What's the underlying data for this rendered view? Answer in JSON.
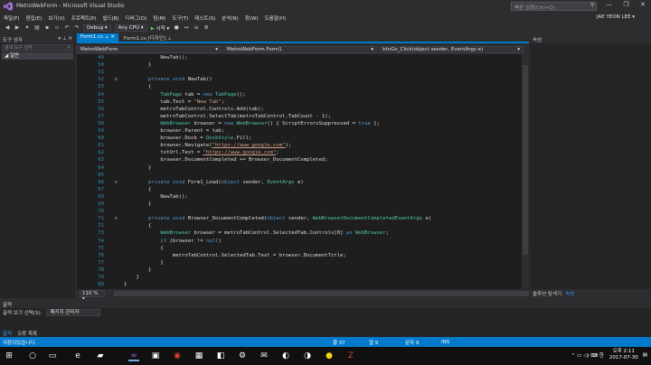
{
  "window": {
    "title": "MetroWebForm - Microsoft Visual Studio",
    "quick_launch_placeholder": "빠른 실행(Ctrl+Q)",
    "user": "JAE YEON LEE ▾"
  },
  "menu": [
    "파일(F)",
    "편집(E)",
    "보기(V)",
    "프로젝트(P)",
    "빌드(B)",
    "디버그(D)",
    "팀(M)",
    "도구(T)",
    "테스트(S)",
    "분석(N)",
    "창(W)",
    "도움말(H)"
  ],
  "toolbar": {
    "config": "Debug",
    "platform": "Any CPU",
    "start_label": "시작"
  },
  "toolbox": {
    "title": "도구 상자",
    "search_placeholder": "검색 도구 상자",
    "group": "일반"
  },
  "tabs": [
    {
      "label": "Form1.cs",
      "active": true
    },
    {
      "label": "Form1.cs [디자인]",
      "active": false
    }
  ],
  "nav": {
    "project": "MetroWebForm",
    "class": "MetroWebForm.Form1",
    "member": "btnGo_Click(object sender, EventArgs e)"
  },
  "code": {
    "lines": [
      {
        "n": "49",
        "fold": "",
        "segs": [
          [
            "tx",
            "            NewTab();"
          ]
        ]
      },
      {
        "n": "50",
        "fold": "",
        "segs": [
          [
            "tx",
            "        }"
          ]
        ]
      },
      {
        "n": "51",
        "fold": "",
        "segs": [
          [
            "tx",
            ""
          ]
        ]
      },
      {
        "n": "52",
        "fold": "⊟",
        "segs": [
          [
            "kw",
            "        private void "
          ],
          [
            "tx",
            "NewTab()"
          ]
        ]
      },
      {
        "n": "53",
        "fold": "",
        "segs": [
          [
            "tx",
            "        {"
          ]
        ]
      },
      {
        "n": "54",
        "fold": "",
        "segs": [
          [
            "ty",
            "            TabPage "
          ],
          [
            "tx",
            "tab = "
          ],
          [
            "kw",
            "new "
          ],
          [
            "ty",
            "TabPage"
          ],
          [
            "tx",
            "();"
          ]
        ]
      },
      {
        "n": "55",
        "fold": "",
        "segs": [
          [
            "tx",
            "            tab.Text = "
          ],
          [
            "stp",
            "\"New Tab\""
          ],
          [
            "tx",
            ";"
          ]
        ]
      },
      {
        "n": "56",
        "fold": "",
        "segs": [
          [
            "tx",
            "            metroTabControl.Controls.Add(tab);"
          ]
        ]
      },
      {
        "n": "57",
        "fold": "",
        "segs": [
          [
            "tx",
            "            metroTabControl.SelectTab(metroTabControl.TabCount - 1);"
          ]
        ]
      },
      {
        "n": "58",
        "fold": "",
        "segs": [
          [
            "ty",
            "            WebBrowser "
          ],
          [
            "tx",
            "browser = "
          ],
          [
            "kw",
            "new "
          ],
          [
            "ty",
            "WebBrowser"
          ],
          [
            "tx",
            "() { ScriptErrorsSuppressed = "
          ],
          [
            "kw",
            "true"
          ],
          [
            "tx",
            " };"
          ]
        ]
      },
      {
        "n": "59",
        "fold": "",
        "segs": [
          [
            "tx",
            "            browser.Parent = tab;"
          ]
        ]
      },
      {
        "n": "60",
        "fold": "",
        "segs": [
          [
            "tx",
            "            browser.Dock = "
          ],
          [
            "ty",
            "DockStyle"
          ],
          [
            "tx",
            ".Fill;"
          ]
        ]
      },
      {
        "n": "61",
        "fold": "",
        "segs": [
          [
            "tx",
            "            browser.Navigate("
          ],
          [
            "st",
            "\"https://www.google.com\""
          ],
          [
            "tx",
            ");"
          ]
        ]
      },
      {
        "n": "62",
        "fold": "",
        "segs": [
          [
            "tx",
            "            txtUrl.Text = "
          ],
          [
            "st",
            "\"https://www.google.com\""
          ],
          [
            "tx",
            ";"
          ]
        ]
      },
      {
        "n": "63",
        "fold": "",
        "segs": [
          [
            "tx",
            "            browser.DocumentCompleted += Browser_DocumentCompleted;"
          ]
        ]
      },
      {
        "n": "64",
        "fold": "",
        "segs": [
          [
            "tx",
            "        }"
          ]
        ]
      },
      {
        "n": "65",
        "fold": "",
        "segs": [
          [
            "tx",
            ""
          ]
        ]
      },
      {
        "n": "66",
        "fold": "⊟",
        "segs": [
          [
            "kw",
            "        private void "
          ],
          [
            "tx",
            "Form1_Load("
          ],
          [
            "kw",
            "object "
          ],
          [
            "tx",
            "sender, "
          ],
          [
            "ty",
            "EventArgs "
          ],
          [
            "tx",
            "e)"
          ]
        ]
      },
      {
        "n": "67",
        "fold": "",
        "segs": [
          [
            "tx",
            "        {"
          ]
        ]
      },
      {
        "n": "68",
        "fold": "",
        "segs": [
          [
            "tx",
            "            NewTab();"
          ]
        ]
      },
      {
        "n": "69",
        "fold": "",
        "segs": [
          [
            "tx",
            "        }"
          ]
        ]
      },
      {
        "n": "70",
        "fold": "",
        "segs": [
          [
            "tx",
            ""
          ]
        ]
      },
      {
        "n": "71",
        "fold": "⊟",
        "segs": [
          [
            "kw",
            "        private void "
          ],
          [
            "tx",
            "Browser_DocumentCompleted("
          ],
          [
            "kw",
            "object "
          ],
          [
            "tx",
            "sender, "
          ],
          [
            "ty",
            "WebBrowserDocumentCompletedEventArgs "
          ],
          [
            "tx",
            "e)"
          ]
        ]
      },
      {
        "n": "72",
        "fold": "",
        "segs": [
          [
            "tx",
            "        {"
          ]
        ]
      },
      {
        "n": "73",
        "fold": "",
        "segs": [
          [
            "ty",
            "            WebBrowser "
          ],
          [
            "tx",
            "browser = metroTabControl.SelectedTab.Controls[0] "
          ],
          [
            "kw",
            "as "
          ],
          [
            "ty",
            "WebBrowser"
          ],
          [
            "tx",
            ";"
          ]
        ]
      },
      {
        "n": "74",
        "fold": "",
        "segs": [
          [
            "kw",
            "            if "
          ],
          [
            "tx",
            "(browser != "
          ],
          [
            "kw",
            "null"
          ],
          [
            "tx",
            ")"
          ]
        ]
      },
      {
        "n": "75",
        "fold": "",
        "segs": [
          [
            "tx",
            "            {"
          ]
        ]
      },
      {
        "n": "76",
        "fold": "",
        "segs": [
          [
            "tx",
            "                metroTabControl.SelectedTab.Text = browser.DocumentTitle;"
          ]
        ]
      },
      {
        "n": "77",
        "fold": "",
        "segs": [
          [
            "tx",
            "            }"
          ]
        ]
      },
      {
        "n": "78",
        "fold": "",
        "segs": [
          [
            "tx",
            "        }"
          ]
        ]
      },
      {
        "n": "79",
        "fold": "",
        "segs": [
          [
            "tx",
            "    }"
          ]
        ]
      },
      {
        "n": "80",
        "fold": "",
        "segs": [
          [
            "tx",
            "}"
          ]
        ]
      }
    ]
  },
  "zoom": "110 %",
  "properties": {
    "title": "속성",
    "tab_solution": "솔루션 탐색기",
    "tab_properties": "속성"
  },
  "output": {
    "title": "출력",
    "source_label": "출력 보기 선택(S):",
    "source_value": "패키지 관리자",
    "tab_output": "출력",
    "tab_errors": "오류 목록"
  },
  "status": {
    "text": "저장되었습니다.",
    "line": "줄 37",
    "col": "열 9",
    "char": "문자 9",
    "mode": "INS"
  },
  "clock": {
    "time": "오후 2:11",
    "date": "2017-07-30"
  },
  "colors": {
    "accent": "#007acc",
    "background": "#1e1e1e"
  }
}
